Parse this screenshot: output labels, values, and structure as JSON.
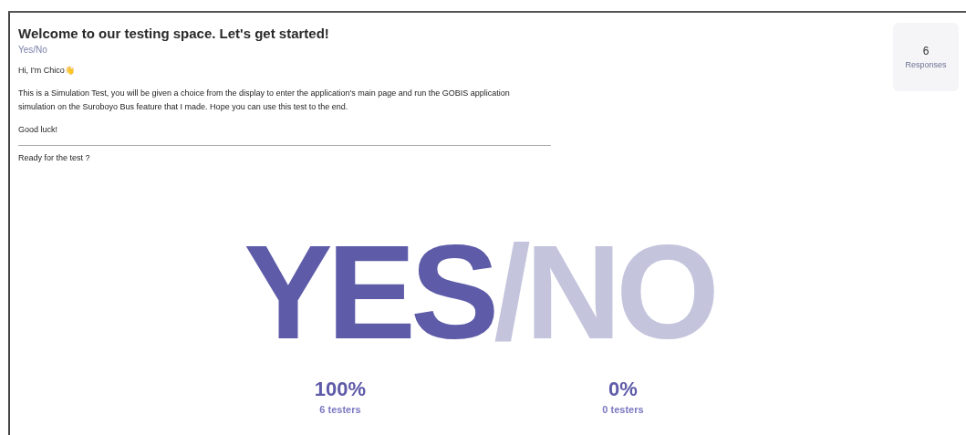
{
  "question": {
    "title": "Welcome to our testing space. Let's get started!",
    "type": "Yes/No",
    "paragraphs": [
      "Hi, I'm Chico👋",
      "This is a Simulation Test, you will be given a choice from the display to enter the application's main page and run the GOBIS application simulation on the Suroboyo Bus feature that I made. Hope you can use this test to the end.",
      "Good luck!"
    ],
    "prompt": "Ready for the test ?"
  },
  "responses": {
    "count": "6",
    "label": "Responses"
  },
  "answers": [
    {
      "word": "YES",
      "percent": "100%",
      "testers": "6 testers",
      "selected": true
    },
    {
      "word": "/NO",
      "percent": "0%",
      "testers": "0 testers",
      "selected": false
    }
  ]
}
